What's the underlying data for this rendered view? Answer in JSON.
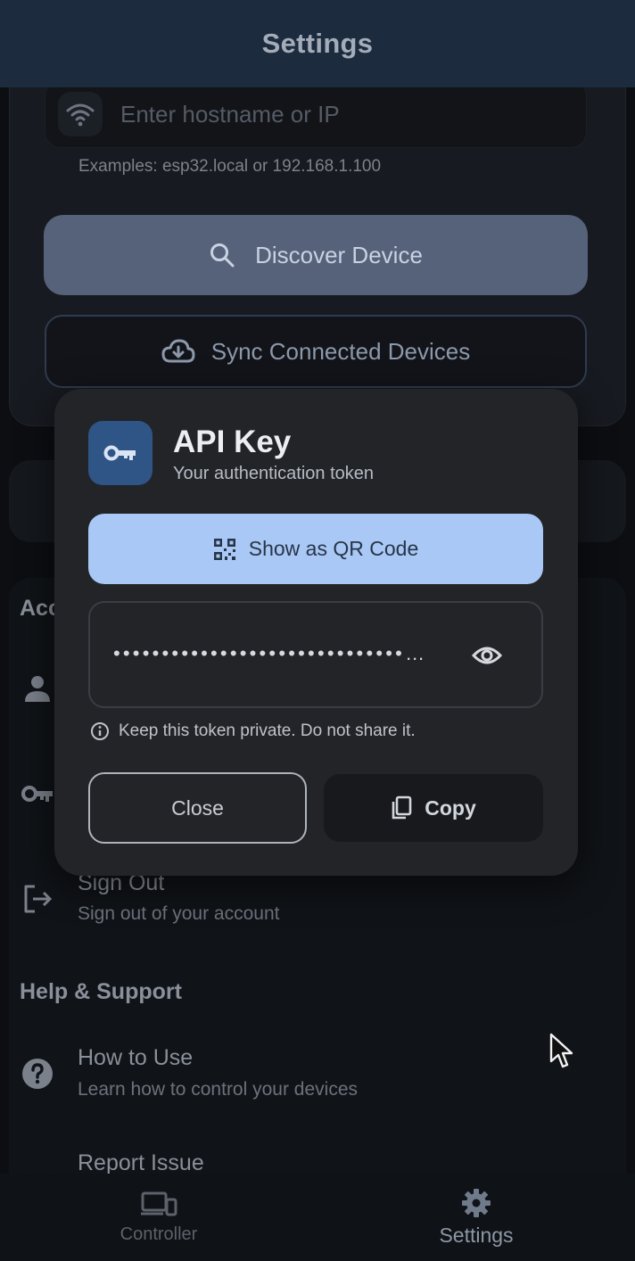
{
  "header": {
    "title": "Settings"
  },
  "connection": {
    "host_placeholder": "Enter hostname or IP",
    "examples": "Examples: esp32.local or 192.168.1.100",
    "discover_label": "Discover Device",
    "sync_label": "Sync Connected Devices"
  },
  "account": {
    "section_title": "Acc",
    "sign_out_title": "Sign Out",
    "sign_out_sub": "Sign out of your account"
  },
  "help": {
    "section_title": "Help & Support",
    "how_to_title": "How to Use",
    "how_to_sub": "Learn how to control your devices",
    "report_title": "Report Issue"
  },
  "dialog": {
    "title": "API Key",
    "subtitle": "Your authentication token",
    "qr_label": "Show as QR Code",
    "token_masked": "••••••••••••••••••••••••••••••…",
    "warning": "Keep this token private. Do not share it.",
    "close_label": "Close",
    "copy_label": "Copy"
  },
  "nav": {
    "items": [
      {
        "label": "Controller",
        "icon": "devices-icon"
      },
      {
        "label": "Settings",
        "icon": "gear-icon"
      }
    ],
    "active": "Settings"
  },
  "colors": {
    "header_bg": "#1c2b3e",
    "accent_light": "#a9c8f5",
    "key_tile": "#2f5486",
    "dialog_bg": "#222428"
  }
}
